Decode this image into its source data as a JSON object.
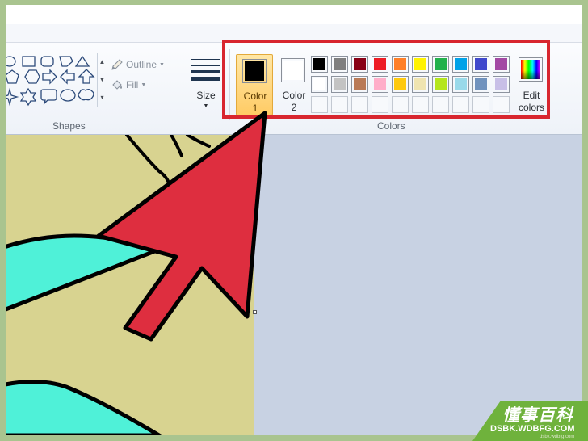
{
  "ribbon": {
    "shapes_group_label": "Shapes",
    "outline_label": "Outline",
    "fill_label": "Fill",
    "size_label": "Size",
    "colors_group_label": "Colors",
    "color1": {
      "label_line1": "Color",
      "label_line2": "1",
      "value": "#000000",
      "selected": true
    },
    "color2": {
      "label_line1": "Color",
      "label_line2": "2",
      "value": "#ffffff"
    },
    "edit_colors": {
      "label_line1": "Edit",
      "label_line2": "colors"
    },
    "palette_row1": [
      "#000000",
      "#7f7f7f",
      "#880015",
      "#ed1c24",
      "#ff7f27",
      "#fff200",
      "#22b14c",
      "#00a2e8",
      "#3f48cc",
      "#a349a4"
    ],
    "palette_row2": [
      "#ffffff",
      "#c3c3c3",
      "#b97a57",
      "#ffaec9",
      "#ffc90e",
      "#efe4b0",
      "#b5e61d",
      "#99d9ea",
      "#7092be",
      "#c8bfe7"
    ],
    "palette_row3_custom_slots": 10
  },
  "colors": {
    "highlight_border": "#d8262f",
    "pointer_arrow": "#de2e3f",
    "canvas_background": "#d8d390",
    "canvas_drawing_fill": "#4ff1d8",
    "workspace": "#c8d2e3",
    "outer_border": "#a9c48f",
    "watermark": "#6fb23c"
  },
  "watermark": {
    "chinese": "懂事百科",
    "domain": "DSBK.WDBFG.COM",
    "small": "dsbk.wdbfg.com"
  }
}
